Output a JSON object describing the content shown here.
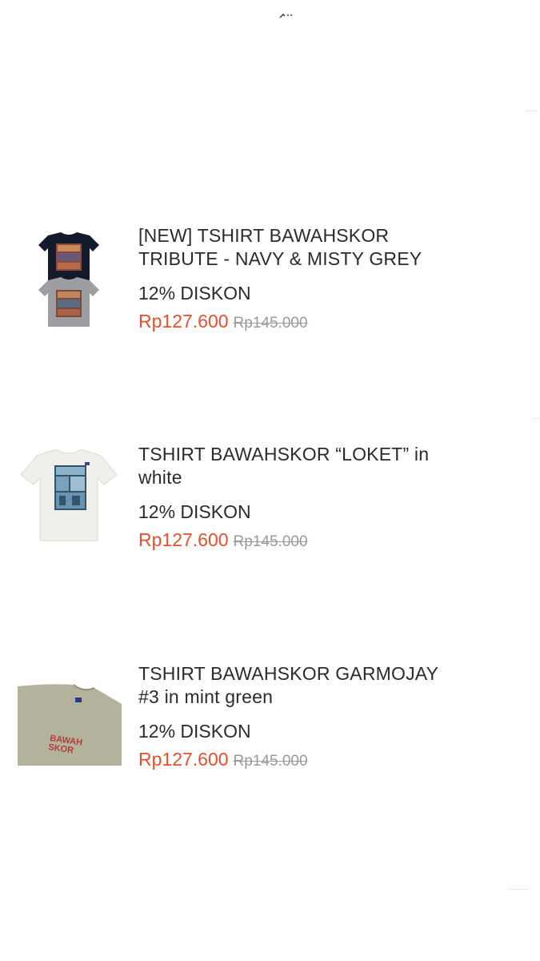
{
  "products": [
    {
      "title_line1": "[NEW] TSHIRT BAWAHSKOR",
      "title_line2": "TRIBUTE - NAVY & MISTY GREY",
      "discount": "12% DISKON",
      "price_now": "Rp127.600",
      "price_was": "Rp145.000",
      "image": "tshirt-navy-grey-photo"
    },
    {
      "title_line1": "TSHIRT BAWAHSKOR “LOKET” in",
      "title_line2": "white",
      "discount": "12% DISKON",
      "price_now": "Rp127.600",
      "price_was": "Rp145.000",
      "image": "tshirt-white-loket-photo"
    },
    {
      "title_line1": "TSHIRT BAWAHSKOR GARMOJAY",
      "title_line2": "#3 in mint green",
      "discount": "12% DISKON",
      "price_now": "Rp127.600",
      "price_was": "Rp145.000",
      "image": "tshirt-mint-green-photo",
      "print_text_1": "BAWAH",
      "print_text_2": "SKOR"
    }
  ],
  "colors": {
    "price_accent": "#e2502c",
    "price_strike": "#9a9a9a",
    "text": "#2b2b2b"
  }
}
